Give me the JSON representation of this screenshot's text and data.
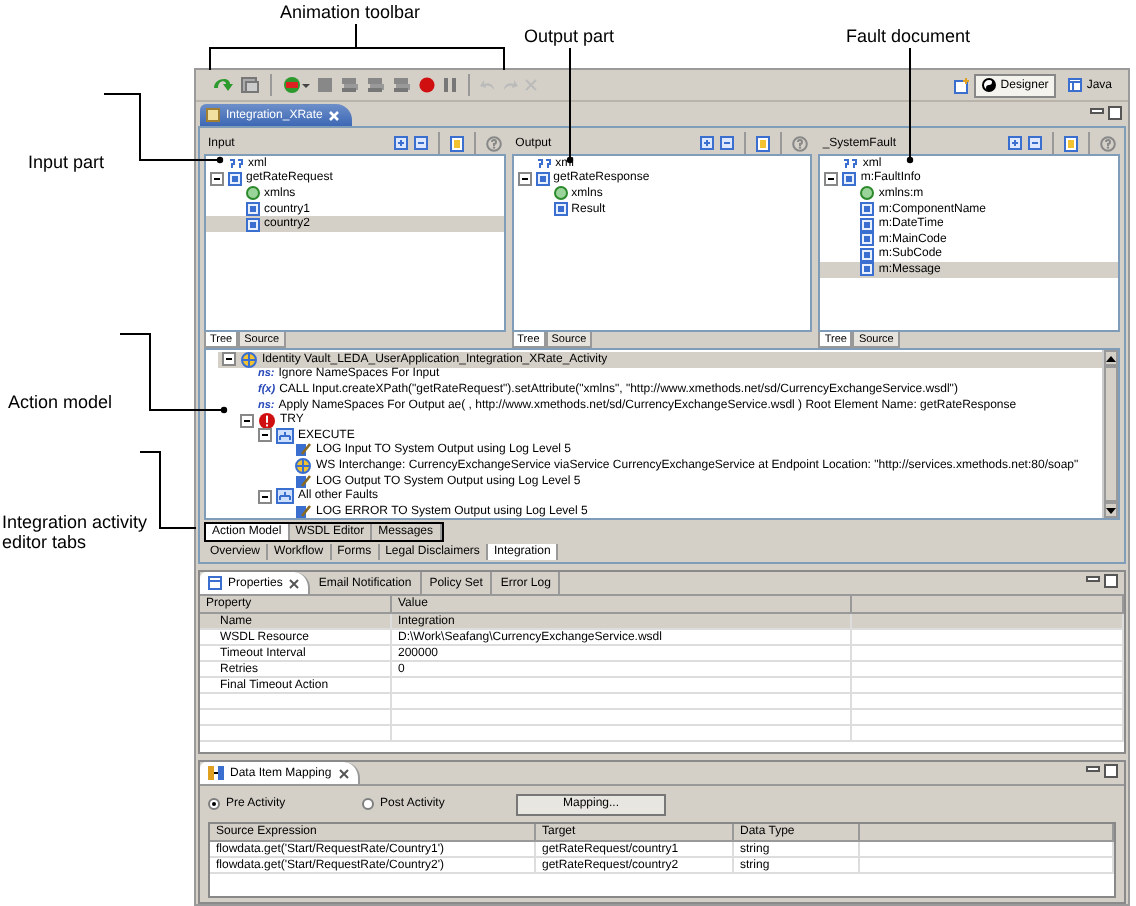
{
  "annotations": {
    "animation_toolbar": "Animation toolbar",
    "output_part": "Output part",
    "fault_document": "Fault document",
    "input_part": "Input part",
    "action_model": "Action model",
    "editor_tabs": "Integration activity editor tabs"
  },
  "perspectives": [
    {
      "label": "Designer",
      "selected": true
    },
    {
      "label": "Java",
      "selected": false
    }
  ],
  "editor_tab": {
    "title": "Integration_XRate"
  },
  "panels": [
    {
      "title": "Input",
      "tree": [
        {
          "label": "xml",
          "kind": "pi",
          "selected": false
        },
        {
          "label": "getRateRequest",
          "kind": "element",
          "selected": false,
          "expanded": true,
          "children": [
            {
              "label": "xmlns",
              "kind": "attr",
              "selected": false
            },
            {
              "label": "country1",
              "kind": "element",
              "selected": false
            },
            {
              "label": "country2",
              "kind": "element",
              "selected": true
            }
          ]
        }
      ],
      "tabs": [
        {
          "label": "Tree",
          "selected": true
        },
        {
          "label": "Source",
          "selected": false
        }
      ]
    },
    {
      "title": "Output",
      "tree": [
        {
          "label": "xml",
          "kind": "pi",
          "selected": false
        },
        {
          "label": "getRateResponse",
          "kind": "element",
          "selected": false,
          "expanded": true,
          "children": [
            {
              "label": "xmlns",
              "kind": "attr",
              "selected": false
            },
            {
              "label": "Result",
              "kind": "element",
              "selected": false
            }
          ]
        }
      ],
      "tabs": [
        {
          "label": "Tree",
          "selected": true
        },
        {
          "label": "Source",
          "selected": false
        }
      ]
    },
    {
      "title": "_SystemFault",
      "tree": [
        {
          "label": "xml",
          "kind": "pi",
          "selected": false
        },
        {
          "label": "m:FaultInfo",
          "kind": "element",
          "selected": false,
          "expanded": true,
          "children": [
            {
              "label": "xmlns:m",
              "kind": "attr",
              "selected": false
            },
            {
              "label": "m:ComponentName",
              "kind": "element",
              "selected": false
            },
            {
              "label": "m:DateTime",
              "kind": "element",
              "selected": false
            },
            {
              "label": "m:MainCode",
              "kind": "element",
              "selected": false
            },
            {
              "label": "m:SubCode",
              "kind": "element",
              "selected": false
            },
            {
              "label": "m:Message",
              "kind": "element",
              "selected": true
            }
          ]
        }
      ],
      "tabs": [
        {
          "label": "Tree",
          "selected": true
        },
        {
          "label": "Source",
          "selected": false
        }
      ]
    }
  ],
  "action_model": [
    {
      "label": "Identity Vault_LEDA_UserApplication_Integration_XRate_Activity",
      "kind": "activity",
      "selected": true,
      "expanded": true,
      "children": [
        {
          "label": "Ignore NameSpaces For  Input",
          "kind": "ns",
          "marker": "ns:",
          "selected": false
        },
        {
          "label": "CALL Input.createXPath(\"getRateRequest\").setAttribute(\"xmlns\", \"http://www.xmethods.net/sd/CurrencyExchangeService.wsdl\")",
          "kind": "fx",
          "marker": "f(x)",
          "selected": false
        },
        {
          "label": "Apply NameSpaces For  Output  ae(  , http://www.xmethods.net/sd/CurrencyExchangeService.wsdl )  Root Element Name: getRateResponse",
          "kind": "ns",
          "marker": "ns:",
          "selected": false
        },
        {
          "label": "TRY",
          "kind": "try",
          "selected": false,
          "expanded": true,
          "children": [
            {
              "label": "EXECUTE",
              "kind": "block",
              "selected": false,
              "expanded": true,
              "children": [
                {
                  "label": "LOG Input TO System Output using Log Level 5",
                  "kind": "log",
                  "selected": false
                },
                {
                  "label": "WS Interchange: CurrencyExchangeService viaService CurrencyExchangeService at Endpoint Location: \"http://services.xmethods.net:80/soap\"",
                  "kind": "ws",
                  "selected": false
                },
                {
                  "label": "LOG Output TO System Output using Log Level 5",
                  "kind": "log",
                  "selected": false
                }
              ]
            },
            {
              "label": "All other Faults",
              "kind": "block",
              "selected": false,
              "expanded": true,
              "children": [
                {
                  "label": "LOG ERROR TO System Output using Log Level 5",
                  "kind": "log",
                  "selected": false
                }
              ]
            }
          ]
        }
      ]
    }
  ],
  "action_tabs": [
    {
      "label": "Action Model",
      "selected": true
    },
    {
      "label": "WSDL Editor",
      "selected": false
    },
    {
      "label": "Messages",
      "selected": false
    }
  ],
  "editor_pages": [
    {
      "label": "Overview",
      "selected": false
    },
    {
      "label": "Workflow",
      "selected": false
    },
    {
      "label": "Forms",
      "selected": false
    },
    {
      "label": "Legal Disclaimers",
      "selected": false
    },
    {
      "label": "Integration",
      "selected": true
    }
  ],
  "views": [
    {
      "label": "Properties",
      "selected": true
    },
    {
      "label": "Email Notification",
      "selected": false
    },
    {
      "label": "Policy Set",
      "selected": false
    },
    {
      "label": "Error Log",
      "selected": false
    }
  ],
  "properties": {
    "columns": [
      "Property",
      "Value"
    ],
    "rows": [
      {
        "cells": [
          "Name",
          "Integration"
        ],
        "selected": true
      },
      {
        "cells": [
          "WSDL Resource",
          "D:\\Work\\Seafang\\CurrencyExchangeService.wsdl"
        ],
        "selected": false
      },
      {
        "cells": [
          "Timeout Interval",
          "200000"
        ],
        "selected": false
      },
      {
        "cells": [
          "Retries",
          "0"
        ],
        "selected": false
      },
      {
        "cells": [
          "Final Timeout Action",
          ""
        ],
        "selected": false
      }
    ]
  },
  "mapping": {
    "title": "Data Item Mapping",
    "radios": [
      {
        "label": "Pre Activity",
        "selected": true
      },
      {
        "label": "Post Activity",
        "selected": false
      }
    ],
    "button": "Mapping...",
    "columns": [
      "Source Expression",
      "Target",
      "Data Type"
    ],
    "rows": [
      [
        "flowdata.get('Start/RequestRate/Country1')",
        "getRateRequest/country1",
        "string"
      ],
      [
        "flowdata.get('Start/RequestRate/Country2')",
        "getRateRequest/country2",
        "string"
      ]
    ]
  }
}
